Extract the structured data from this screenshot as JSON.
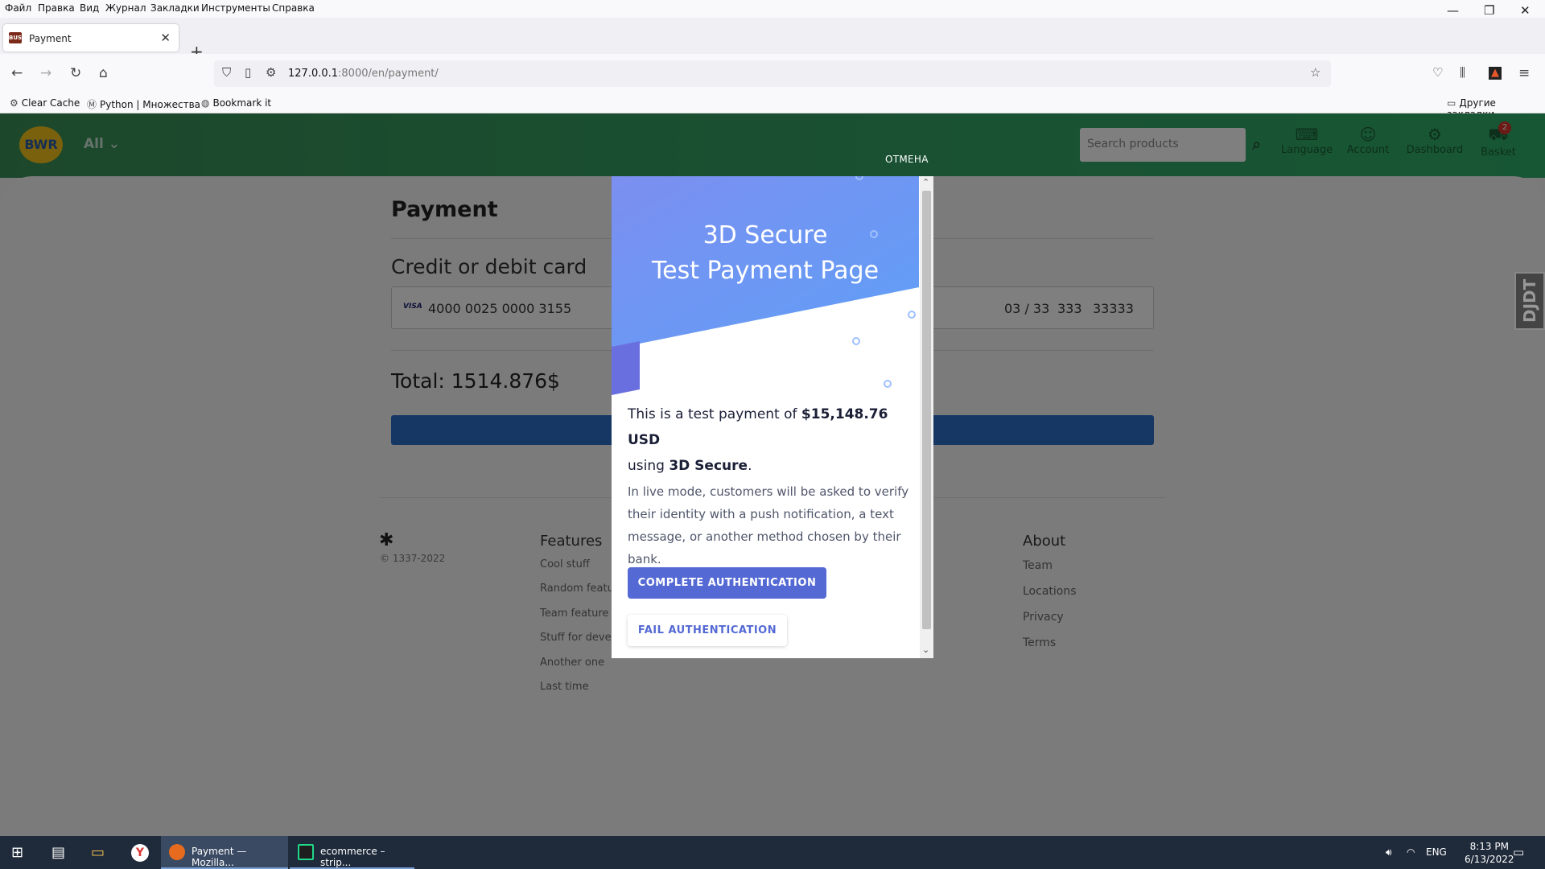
{
  "browser": {
    "menu": [
      "Файл",
      "Правка",
      "Вид",
      "Журнал",
      "Закладки",
      "Инструменты",
      "Справка"
    ],
    "tab_title": "Payment",
    "url_host": "127.0.0.1",
    "url_rest": ":8000/en/payment/",
    "bookmarks": [
      "Clear Cache",
      "Python | Множества",
      "Bookmark it"
    ],
    "other_bookmarks": "Другие закладки"
  },
  "site": {
    "logo": "BWR",
    "category": "All",
    "search_placeholder": "Search products",
    "nav": [
      "Language",
      "Account",
      "Dashboard",
      "Basket"
    ],
    "basket_count": "2"
  },
  "payment": {
    "title": "Payment",
    "card_label": "Credit or debit card",
    "card_brand": "VISA",
    "card_number": "4000 0025 0000 3155",
    "expiry": "03 / 33",
    "cvc": "333",
    "zip": "33333",
    "total": "Total: 1514.876$",
    "cancel_label": "ОТМЕНА"
  },
  "footer": {
    "copyright": "© 1337-2022",
    "features_title": "Features",
    "features": [
      "Cool stuff",
      "Random featu",
      "Team feature",
      "Stuff for devel",
      "Another one",
      "Last time"
    ],
    "about_title": "About",
    "about": [
      "Team",
      "Locations",
      "Privacy",
      "Terms"
    ]
  },
  "modal": {
    "title_line1": "3D Secure",
    "title_line2": "Test Payment Page",
    "lead_pre": "This is a test payment of ",
    "amount": "$15,148.76 USD",
    "lead_mid": "using ",
    "method": "3D Secure",
    "lead_end": ".",
    "sub": "In live mode, customers will be asked to verify their identity with a push notification, a text message, or another method chosen by their bank.",
    "complete_label": "COMPLETE AUTHENTICATION",
    "fail_label": "FAIL AUTHENTICATION"
  },
  "debug_toolbar": "DJDT",
  "taskbar": {
    "app1": "Payment — Mozilla...",
    "app2": "ecommerce – strip...",
    "lang": "ENG",
    "time": "8:13 PM",
    "date": "6/13/2022"
  },
  "colors": {
    "header_green": "#33a365",
    "modal_blue": "#6f9bf5",
    "stripe_purple": "#5469d4",
    "pay_button": "#2c6cc7"
  }
}
